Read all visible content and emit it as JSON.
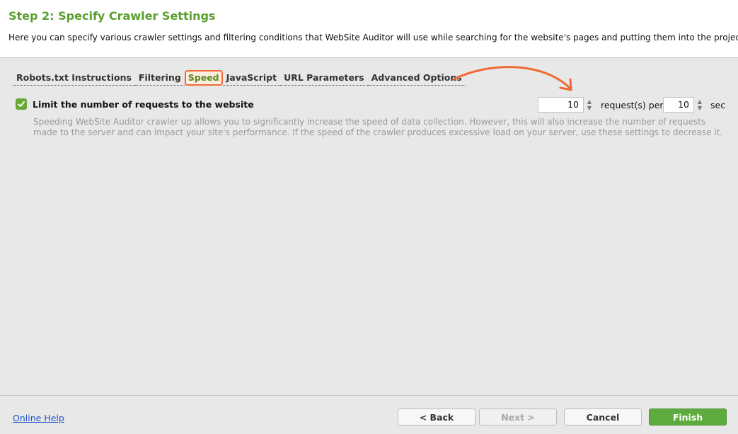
{
  "header": {
    "title": "Step 2: Specify Crawler Settings",
    "description": "Here you can specify various crawler settings and filtering conditions that WebSite Auditor will use while searching for the website's pages and putting them into the project."
  },
  "tabs": [
    {
      "label": "Robots.txt Instructions",
      "active": false
    },
    {
      "label": "Filtering",
      "active": false
    },
    {
      "label": "Speed",
      "active": true
    },
    {
      "label": "JavaScript",
      "active": false
    },
    {
      "label": "URL Parameters",
      "active": false
    },
    {
      "label": "Advanced Options",
      "active": false
    }
  ],
  "speed": {
    "limit_checkbox_label": "Limit the number of requests to the website",
    "limit_checked": true,
    "description": "Speeding WebSite Auditor crawler up allows you to significantly increase the speed of data collection. However, this will also increase the number of requests made to the server and can impact your site's performance. If the speed of the crawler produces excessive load on your server, use these settings to decrease it.",
    "requests_value": "10",
    "requests_unit": "request(s) per",
    "seconds_value": "10",
    "seconds_unit": "sec"
  },
  "footer": {
    "help_label": "Online Help",
    "back_label": "< Back",
    "next_label": "Next >",
    "cancel_label": "Cancel",
    "finish_label": "Finish"
  },
  "colors": {
    "title_green": "#5a9e2f",
    "annotation_orange": "#f06a35",
    "finish_green": "#5cab3c",
    "link_blue": "#1f57c8"
  },
  "icons": {
    "checkbox": "check-icon",
    "spinner_up": "chevron-up-icon",
    "spinner_down": "chevron-down-icon",
    "annotation": "curved-arrow-icon"
  }
}
